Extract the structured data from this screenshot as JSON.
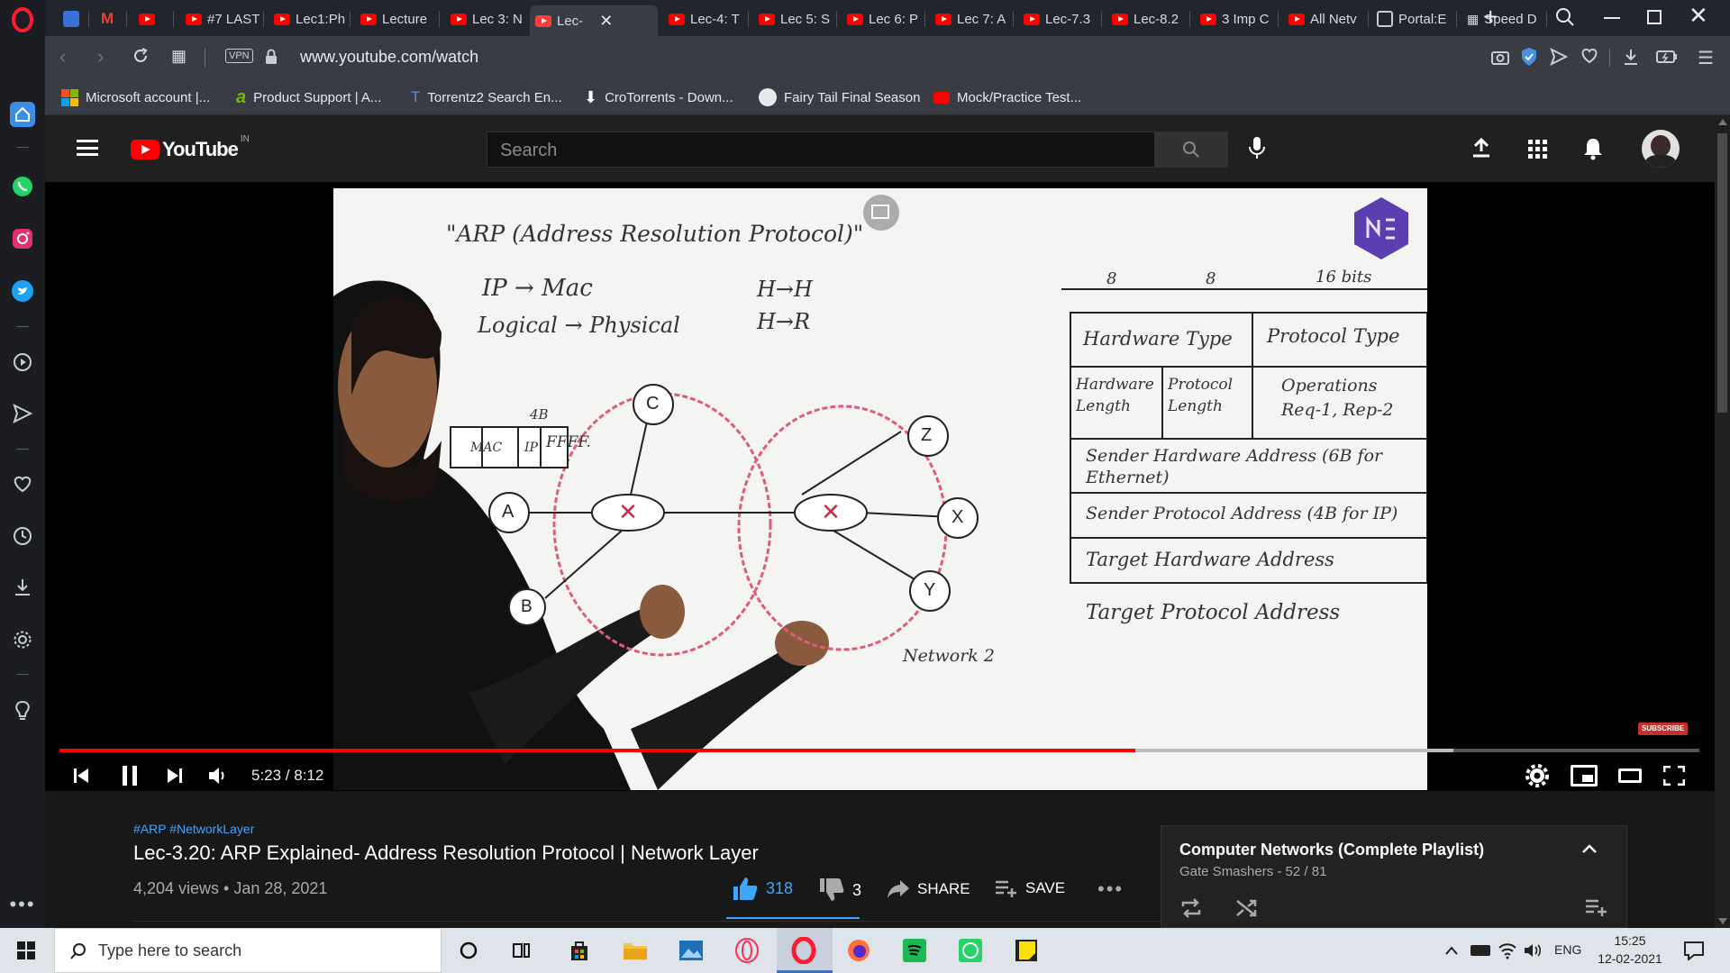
{
  "browser": {
    "tabs": [
      {
        "label": "",
        "icon": "opera-portal-icon"
      },
      {
        "label": "",
        "icon": "gmail-icon"
      },
      {
        "label": "",
        "icon": "youtube-icon"
      },
      {
        "label": "#7 LAST",
        "icon": "youtube-icon"
      },
      {
        "label": "Lec1:Ph",
        "icon": "youtube-icon"
      },
      {
        "label": "Lecture",
        "icon": "youtube-icon"
      },
      {
        "label": "Lec 3: N",
        "icon": "youtube-icon"
      },
      {
        "label": "Lec-",
        "icon": "youtube-icon"
      },
      {
        "label": "Lec-4: T",
        "icon": "youtube-icon"
      },
      {
        "label": "Lec 5: S",
        "icon": "youtube-icon"
      },
      {
        "label": "Lec 6: P",
        "icon": "youtube-icon"
      },
      {
        "label": "Lec 7: A",
        "icon": "youtube-icon"
      },
      {
        "label": "Lec-7.3",
        "icon": "youtube-icon"
      },
      {
        "label": "Lec-8.2",
        "icon": "youtube-icon"
      },
      {
        "label": "3 Imp C",
        "icon": "youtube-icon"
      },
      {
        "label": "All Netv",
        "icon": "youtube-icon"
      },
      {
        "label": "Portal:E",
        "icon": "portal-icon"
      },
      {
        "label": "Speed D",
        "icon": "speed-dial-icon"
      }
    ],
    "url": "www.youtube.com/watch",
    "vpn_label": "VPN",
    "bookmarks": [
      {
        "label": "Microsoft account |..."
      },
      {
        "label": "Product Support | A..."
      },
      {
        "label": "Torrentz2 Search En..."
      },
      {
        "label": "CroTorrents - Down..."
      },
      {
        "label": "Fairy Tail Final Season"
      },
      {
        "label": "Mock/Practice Test..."
      }
    ]
  },
  "youtube": {
    "logo_text": "YouTube",
    "region": "IN",
    "search_placeholder": "Search",
    "player": {
      "time": "5:23 / 8:12",
      "progress": 0.656,
      "buffered": 0.85,
      "subscribe_badge": "SUBSCRIBE"
    },
    "board": {
      "title": "\"ARP (Address Resolution Protocol)\"",
      "line1": "IP → Mac",
      "line2": "Logical → Physical",
      "h2h": "H→H",
      "h2r": "H→R",
      "bits_8a": "8",
      "bits_8b": "8",
      "bits_16": "16 bits",
      "hw_type": "Hardware Type",
      "proto_type": "Protocol Type",
      "hw_len": "Hardware Length",
      "proto_len": "Protocol Length",
      "ops": "Operations Req-1, Rep-2",
      "sha": "Sender Hardware Address (6B for Ethernet)",
      "spa": "Sender Protocol Address (4B for IP)",
      "tha": "Target Hardware Address",
      "tpa": "Target Protocol Address",
      "network2": "Network 2",
      "four_b": "4B",
      "packet_mac": "MAC",
      "packet_ip": "IP",
      "packet_ff": "FFFF.",
      "nodes": [
        "A",
        "B",
        "C",
        "Z",
        "X",
        "Y"
      ]
    },
    "video": {
      "hashtags": "#ARP #NetworkLayer",
      "title": "Lec-3.20: ARP Explained- Address Resolution Protocol | Network Layer",
      "meta": "4,204 views • Jan 28, 2021",
      "likes": "318",
      "dislikes": "3",
      "share": "SHARE",
      "save": "SAVE"
    },
    "playlist": {
      "title": "Computer Networks (Complete Playlist)",
      "meta": "Gate Smashers - 52 / 81"
    }
  },
  "taskbar": {
    "search_placeholder": "Type here to search",
    "lang": "ENG",
    "time": "15:25",
    "date": "12-02-2021"
  },
  "colors": {
    "youtube_red": "#ff0000",
    "like_blue": "#3ea6ff"
  }
}
